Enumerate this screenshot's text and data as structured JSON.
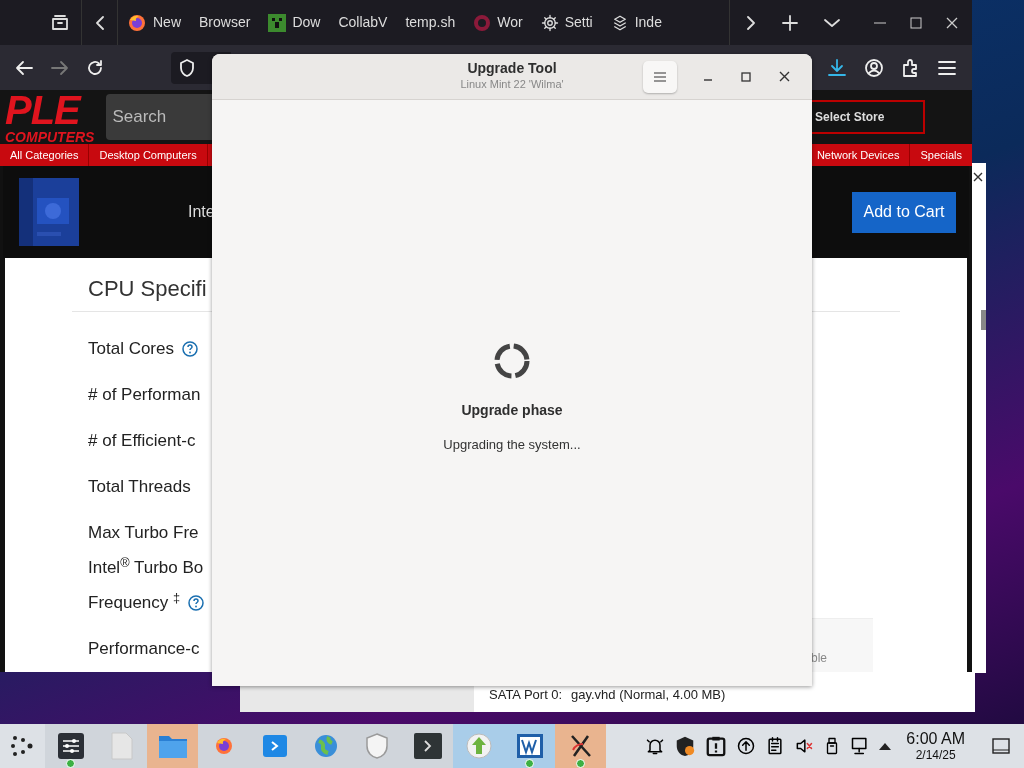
{
  "browser": {
    "tabs": [
      {
        "label": "New"
      },
      {
        "label": "Browser"
      },
      {
        "label": "Dow"
      },
      {
        "label": "CollabV"
      },
      {
        "label": "temp.sh"
      },
      {
        "label": "Wor"
      },
      {
        "label": "Setti"
      },
      {
        "label": "Inde"
      }
    ],
    "site": {
      "logo": "PLE",
      "logo_sub": "COMPUTERS",
      "search_placeholder": "Search",
      "store_button": "Select Store"
    },
    "categories_left": [
      "All Categories",
      "Desktop Computers"
    ],
    "categories_right": [
      "Network Devices",
      "Specials"
    ],
    "product": {
      "title": "Inte",
      "button": "Add to Cart"
    },
    "specs_heading": "CPU Specifi",
    "specs": [
      {
        "label": "Total Cores",
        "help": true
      },
      {
        "label": "# of Performan",
        "help": false
      },
      {
        "label": "# of Efficient-c",
        "help": false
      },
      {
        "label": "Total Threads",
        "help": false
      },
      {
        "label": "Max Turbo Fre",
        "help": false
      },
      {
        "label": "Intel$^{®}$ Turbo Bo",
        "help": false
      },
      {
        "label": "Frequency $^{‡}$",
        "help": true
      },
      {
        "label": "Performance-c",
        "help": false
      }
    ],
    "side_note": "ble"
  },
  "dialog": {
    "title": "Upgrade Tool",
    "subtitle": "Linux Mint 22 'Wilma'",
    "heading": "Upgrade phase",
    "status": "Upgrading the system..."
  },
  "background_window": {
    "rows": [
      {
        "label": "SATA Port 0:",
        "value": "gay.vhd (Normal, 4.00 MB)"
      }
    ]
  },
  "taskbar": {
    "apps": [
      {
        "badge": true
      },
      {
        "badge": false
      },
      {
        "badge": false,
        "color": "#e9b48f"
      },
      {
        "badge": false
      },
      {
        "badge": false
      },
      {
        "badge": false
      },
      {
        "badge": false
      },
      {
        "badge": false
      },
      {
        "badge": false,
        "color": "#a9cde9"
      },
      {
        "badge": true,
        "color": "#a9cde9"
      },
      {
        "badge": true,
        "color": "#e9b48f"
      }
    ],
    "time": "6:00 AM",
    "date": "2/14/25"
  }
}
